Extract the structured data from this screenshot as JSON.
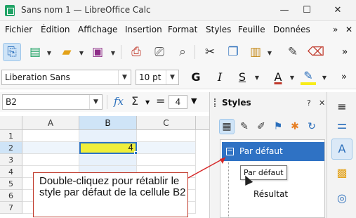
{
  "window": {
    "title": "Sans nom 1 — LibreOffice Calc",
    "minimize": "—",
    "maximize": "☐",
    "close": "✕"
  },
  "menu": {
    "items": [
      "Fichier",
      "Édition",
      "Affichage",
      "Insertion",
      "Format",
      "Styles",
      "Feuille",
      "Données"
    ],
    "overflow": "»",
    "close": "✕"
  },
  "toolbar": {
    "icons": [
      "load-remote-icon",
      "new-icon",
      "open-icon",
      "save-icon",
      "export-pdf-icon",
      "print-icon",
      "print-preview-icon",
      "cut-icon",
      "copy-icon",
      "paste-icon",
      "clone-formatting-icon",
      "clear-formatting-icon"
    ],
    "overflow": "»"
  },
  "format": {
    "font_name": "Liberation Sans",
    "font_size": "10 pt",
    "bold": "G",
    "italic": "I",
    "underline": "S",
    "font_color": "A",
    "overflow": "»",
    "highlight_color": "#f8ec1a",
    "font_color_bar": "#c0392b"
  },
  "formula": {
    "cell_ref": "B2",
    "fx": "fx",
    "sigma": "Σ",
    "equals": "=",
    "count": "4"
  },
  "sheet": {
    "columns": [
      "A",
      "B",
      "C"
    ],
    "rows": [
      "1",
      "2",
      "3",
      "4",
      "5",
      "6",
      "7"
    ],
    "active_value": "4",
    "active_color": "#f0ef3a"
  },
  "callout": {
    "text": "Double-cliquez pour rétablir le style par défaut de la cellule B2",
    "border_color": "#c0392b"
  },
  "sidebar": {
    "title": "Styles",
    "help": "?",
    "close": "✕",
    "menu": "≡",
    "selected_style": "Par défaut",
    "tooltip": "Par défaut",
    "item": "Résultat",
    "select_color": "#2f72c4"
  }
}
